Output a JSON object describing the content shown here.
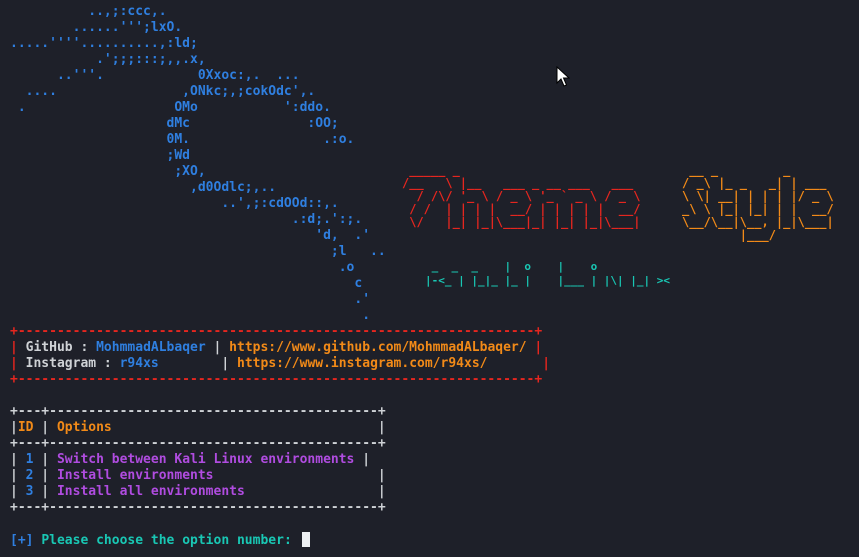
{
  "banner": {
    "ascii_dragon": "          ..,;:ccc,.\n        ......''';lxO.\n.....''''..........,:ld;\n           .';;;:::;,,.x,\n      ..'''.            0Xxoc:,.  ...\n  ....                ,ONkc;,;cokOdc',.\n .                   OMo           ':ddo.\n                    dMc               :OO;\n                    0M.                 .:o.\n                    ;Wd\n                     ;XO,\n                       ,d0Odlc;,..\n                           ..',;:cdOOd::,.\n                                    .:d;.':;.\n                                       'd,  .'\n                                         ;l   ..\n                                          .o\n                                            c\n                                            .'\n                                             .",
    "title_theme": " _____ _\n/__   \\ |__   ___ _ __ ___   ___\n  / /\\/ '_ \\ / _ \\ '_ ` _ \\ / _ \\\n / /  | | | |  __/ | | | | |  __/\n \\/   |_| |_|\\___|_| |_| |_|\\___|",
    "title_style": " __ _         _\n/ _\\ |_ _   _| | ___\n\\ \\| __| | | | |/ _ \\\n_\\ \\ |_| |_| | |  __/\n\\__/\\__|\\__, |_|\\___|\n        |___/",
    "subtitle_art": " _  _  _    |  o    |    o\n|-<_ | |_|_ |_ |    |___ | |\\| |_| ><"
  },
  "social": {
    "border_top": "+------------------------------------------------------------------+",
    "github_label": "GitHub",
    "github_user": "MohmmadALbaqer",
    "github_url": "https://www.github.com/MohmmadALbaqer/",
    "instagram_label": "Instagram",
    "instagram_user": "r94xs",
    "instagram_url": "https://www.instagram.com/r94xs/",
    "border_bottom": "+------------------------------------------------------------------+"
  },
  "menu": {
    "border": "+---+------------------------------------------+",
    "header_id": "ID",
    "header_options": "Options",
    "items": [
      {
        "id": "1",
        "label": "Switch between Kali Linux environments"
      },
      {
        "id": "2",
        "label": "Install environments"
      },
      {
        "id": "3",
        "label": "Install all environments"
      }
    ]
  },
  "prompt": {
    "prefix": "[+]",
    "text": "Please choose the option number:"
  },
  "colors": {
    "background": "#1e2029",
    "blue": "#2f7fe0",
    "red": "#e5261f",
    "orange": "#f28a18",
    "teal": "#19c7b4",
    "purple": "#b04ce0",
    "text": "#cfd2d6"
  }
}
